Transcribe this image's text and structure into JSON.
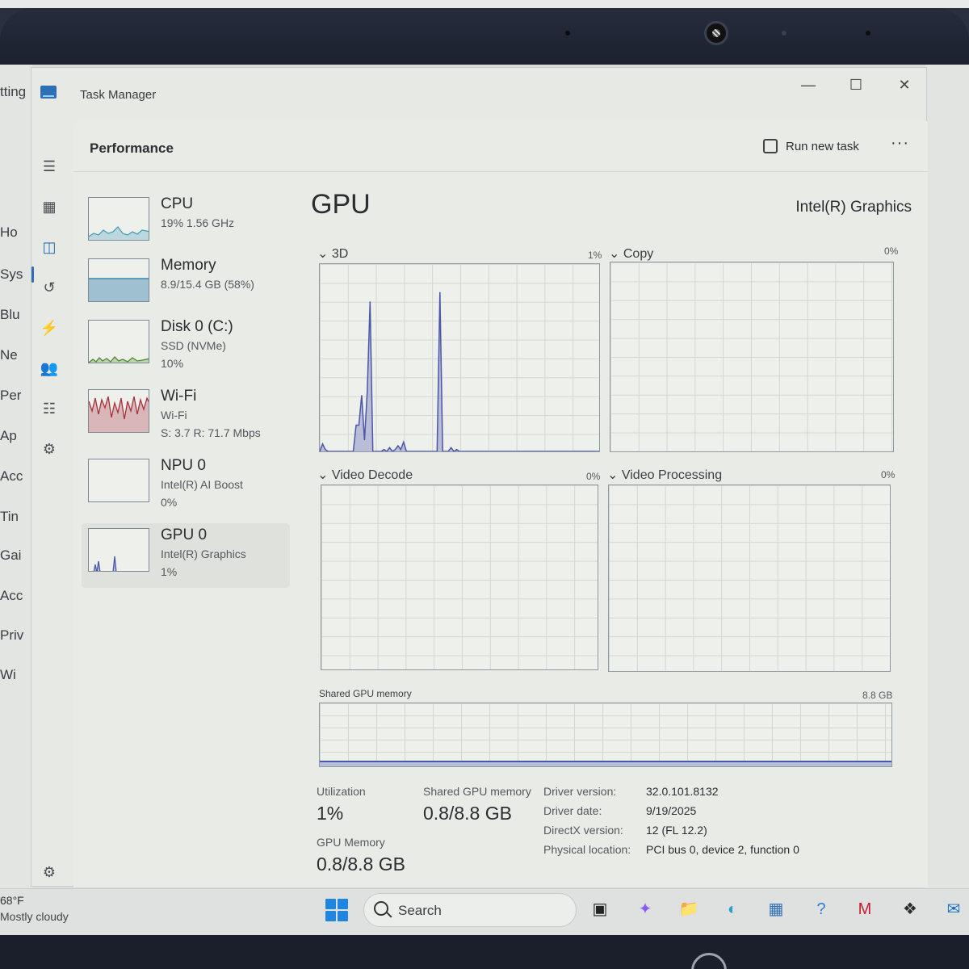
{
  "desktop": {
    "settings_visible_items": [
      "tting",
      "Ho",
      "Sys",
      "Blu",
      "Ne",
      "Per",
      "Ap",
      "Acc",
      "Tin",
      "Gai",
      "Acc",
      "Priv",
      "Wi"
    ]
  },
  "window": {
    "title": "Task Manager",
    "controls": {
      "minimize": "—",
      "maximize": "☐",
      "close": "✕"
    }
  },
  "nav": {
    "items": [
      {
        "name": "hamburger-menu-icon",
        "glyph": "☰"
      },
      {
        "name": "processes-icon",
        "glyph": "▦"
      },
      {
        "name": "performance-icon",
        "glyph": "◫",
        "active": true
      },
      {
        "name": "app-history-icon",
        "glyph": "↺"
      },
      {
        "name": "startup-apps-icon",
        "glyph": "⚡"
      },
      {
        "name": "users-icon",
        "glyph": "👥"
      },
      {
        "name": "details-icon",
        "glyph": "☷"
      },
      {
        "name": "services-icon",
        "glyph": "⚙"
      }
    ],
    "settings_glyph": "⚙"
  },
  "header": {
    "page_title": "Performance",
    "run_new_task": "Run new task",
    "more": "···"
  },
  "devices": [
    {
      "name": "CPU",
      "line2": "19%  1.56 GHz",
      "line3": "",
      "color": "#4a9fb8"
    },
    {
      "name": "Memory",
      "line2": "8.9/15.4 GB (58%)",
      "line3": "",
      "color": "#3b86b0"
    },
    {
      "name": "Disk 0 (C:)",
      "line2": "SSD (NVMe)",
      "line3": "10%",
      "color": "#4e8a2a"
    },
    {
      "name": "Wi-Fi",
      "line2": "Wi-Fi",
      "line3": "S: 3.7  R: 71.7 Mbps",
      "color": "#a8323c"
    },
    {
      "name": "NPU 0",
      "line2": "Intel(R) AI Boost",
      "line3": "0%",
      "color": "#6e7fa0"
    },
    {
      "name": "GPU 0",
      "line2": "Intel(R) Graphics",
      "line3": "1%",
      "color": "#4b57a8",
      "selected": true
    }
  ],
  "gpu": {
    "heading": "GPU",
    "model": "Intel(R) Graphics",
    "engines": [
      {
        "label": "3D",
        "pct": "1%"
      },
      {
        "label": "Copy",
        "pct": "0%"
      },
      {
        "label": "Video Decode",
        "pct": "0%"
      },
      {
        "label": "Video Processing",
        "pct": "0%"
      }
    ],
    "shared_memory_label": "Shared GPU memory",
    "shared_memory_max": "8.8 GB",
    "utilization_label": "Utilization",
    "utilization_value": "1%",
    "shared_gpu_memory_label": "Shared GPU memory",
    "shared_gpu_memory_value": "0.8/8.8 GB",
    "gpu_memory_label": "GPU Memory",
    "gpu_memory_value": "0.8/8.8 GB",
    "details": [
      {
        "key": "Driver version:",
        "value": "32.0.101.8132"
      },
      {
        "key": "Driver date:",
        "value": "9/19/2025"
      },
      {
        "key": "DirectX version:",
        "value": "12 (FL 12.2)"
      },
      {
        "key": "Physical location:",
        "value": "PCI bus 0, device 2, function 0"
      }
    ],
    "series_3d": [
      0,
      4,
      1,
      0,
      0,
      0,
      0,
      0,
      0,
      0,
      0,
      0,
      0,
      14,
      14,
      30,
      6,
      32,
      80,
      0,
      0,
      0,
      0,
      1,
      0,
      2,
      0,
      1,
      3,
      1,
      5,
      0,
      0,
      0,
      0,
      0,
      0,
      0,
      0,
      0,
      0,
      0,
      0,
      85,
      0,
      0,
      0,
      2,
      0,
      1,
      0,
      0,
      0,
      0,
      0,
      0,
      0,
      0,
      0,
      0,
      0,
      0,
      0,
      0,
      0,
      0,
      0,
      0,
      0,
      0,
      0,
      0,
      0,
      0,
      0,
      0,
      0,
      0,
      0,
      0,
      0,
      0,
      0,
      0,
      0,
      0,
      0,
      0,
      0,
      0,
      0,
      0,
      0,
      0,
      0,
      0,
      0,
      0,
      0,
      0,
      0
    ],
    "series_3d_max": 100,
    "shared_memory_fraction": 0.09
  },
  "taskbar": {
    "weather_temp": "68°F",
    "weather_desc": "Mostly cloudy",
    "search": "Search",
    "apps": [
      {
        "name": "task-view-icon",
        "glyph": "▣",
        "color": "#222222"
      },
      {
        "name": "copilot-icon",
        "glyph": "✦",
        "color": "#8a5cf6"
      },
      {
        "name": "file-explorer-icon",
        "glyph": "📁",
        "color": "#e8b33c"
      },
      {
        "name": "edge-icon",
        "glyph": "◐",
        "color": "#2aa0c8"
      },
      {
        "name": "store-icon",
        "glyph": "▦",
        "color": "#2e6fb5"
      },
      {
        "name": "help-icon",
        "glyph": "?",
        "color": "#2e7cd6"
      },
      {
        "name": "mcafee-icon",
        "glyph": "M",
        "color": "#c0202e"
      },
      {
        "name": "dropbox-icon",
        "glyph": "❖",
        "color": "#2b2d30"
      },
      {
        "name": "outlook-icon",
        "glyph": "✉",
        "color": "#1a6fc1"
      }
    ]
  }
}
